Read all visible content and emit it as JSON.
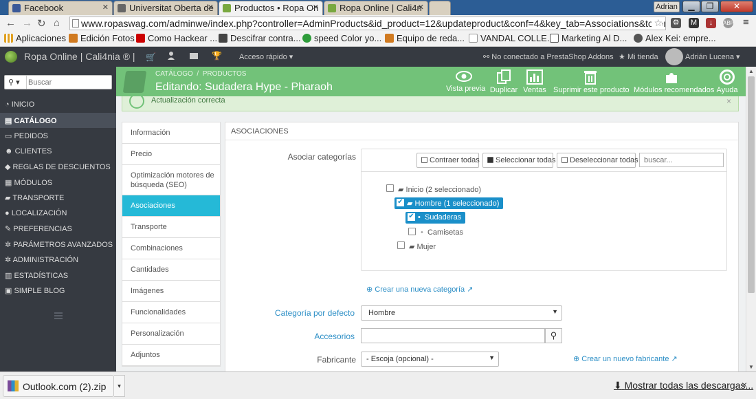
{
  "browser": {
    "tabs": [
      {
        "title": "Facebook",
        "favicon_color": "#3b5998"
      },
      {
        "title": "Universitat Oberta de",
        "favicon_color": "#666666"
      },
      {
        "title": "Productos • Ropa On",
        "favicon_color": "#79a83f"
      },
      {
        "title": "Ropa Online | Cali4n",
        "favicon_color": "#79a83f"
      }
    ],
    "user": "Adrian",
    "url": "www.ropaswag.com/adminwe/index.php?controller=AdminProducts&id_product=12&updateproduct&conf=4&key_tab=Associations&token=f2",
    "bookmarks": [
      {
        "label": "Aplicaciones",
        "color": "#e0a020"
      },
      {
        "label": "Edición Fotos",
        "color": "#d07a20"
      },
      {
        "label": "Como Hackear ...",
        "color": "#cc0000"
      },
      {
        "label": "Descifrar contra...",
        "color": "#444444"
      },
      {
        "label": "speed Color yo...",
        "color": "#2e9c3a"
      },
      {
        "label": "Equipo de reda...",
        "color": "#d07a20"
      },
      {
        "label": "VANDAL COLLE...",
        "color": "#999999"
      },
      {
        "label": "Marketing Al D...",
        "color": "#555555"
      },
      {
        "label": "Alex Kei: empre...",
        "color": "#555555"
      }
    ]
  },
  "topnav": {
    "brand": "Ropa Online | Cali4nia ® |",
    "quick_access": "Acceso rápido",
    "addons": "No conectado a PrestaShop Addons",
    "store": "Mi tienda",
    "user": "Adrián Lucena"
  },
  "sidebar": {
    "search_placeholder": "Buscar",
    "items": [
      {
        "label": "Inicio"
      },
      {
        "label": "Catálogo"
      },
      {
        "label": "Pedidos"
      },
      {
        "label": "Clientes"
      },
      {
        "label": "Reglas de descuentos"
      },
      {
        "label": "Módulos"
      },
      {
        "label": "Transporte"
      },
      {
        "label": "Localización"
      },
      {
        "label": "Preferencias"
      },
      {
        "label": "Parámetros avanzados"
      },
      {
        "label": "Administración"
      },
      {
        "label": "Estadísticas"
      },
      {
        "label": "Simple Blog"
      }
    ]
  },
  "header": {
    "breadcrumb_1": "CATÁLOGO",
    "breadcrumb_sep": "/",
    "breadcrumb_2": "PRODUCTOS",
    "title": "Editando: Sudadera Hype - Pharaoh",
    "actions": [
      "Vista previa",
      "Duplicar",
      "Ventas",
      "Suprimir este producto",
      "Módulos recomendados",
      "Ayuda"
    ]
  },
  "alert": {
    "text": "Actualización correcta",
    "close": "×"
  },
  "tabs": [
    "Información",
    "Precio",
    "Optimización motores de búsqueda (SEO)",
    "Asociaciones",
    "Transporte",
    "Combinaciones",
    "Cantidades",
    "Imágenes",
    "Funcionalidades",
    "Personalización",
    "Adjuntos"
  ],
  "panel": {
    "heading": "ASOCIACIONES",
    "categories_label": "Asociar categorías",
    "collapse_all": "Contraer todas",
    "select_all": "Seleccionar todas",
    "deselect_all": "Deseleccionar todas",
    "tree_search_placeholder": "buscar...",
    "tree": {
      "root": "Inicio (2 seleccionado)",
      "hombre": "Hombre (1 seleccionado)",
      "sudaderas": "Sudaderas",
      "camisetas": "Camisetas",
      "mujer": "Mujer"
    },
    "create_category": "Crear una nueva categoría",
    "default_category_label": "Categoría por defecto",
    "default_category_value": "Hombre",
    "accessories_label": "Accesorios",
    "manufacturer_label": "Fabricante",
    "manufacturer_value": "- Escoja (opcional) -",
    "create_manufacturer": "Crear un nuevo fabricante"
  },
  "downloads": {
    "file": "Outlook.com (2).zip",
    "show_all": "Mostrar todas las descargas...",
    "close": "×"
  },
  "colors": {
    "header_green": "#72c279",
    "active_blue": "#25b9d7",
    "dark_nav": "#363a41",
    "tree_select": "#1a8fc9"
  }
}
